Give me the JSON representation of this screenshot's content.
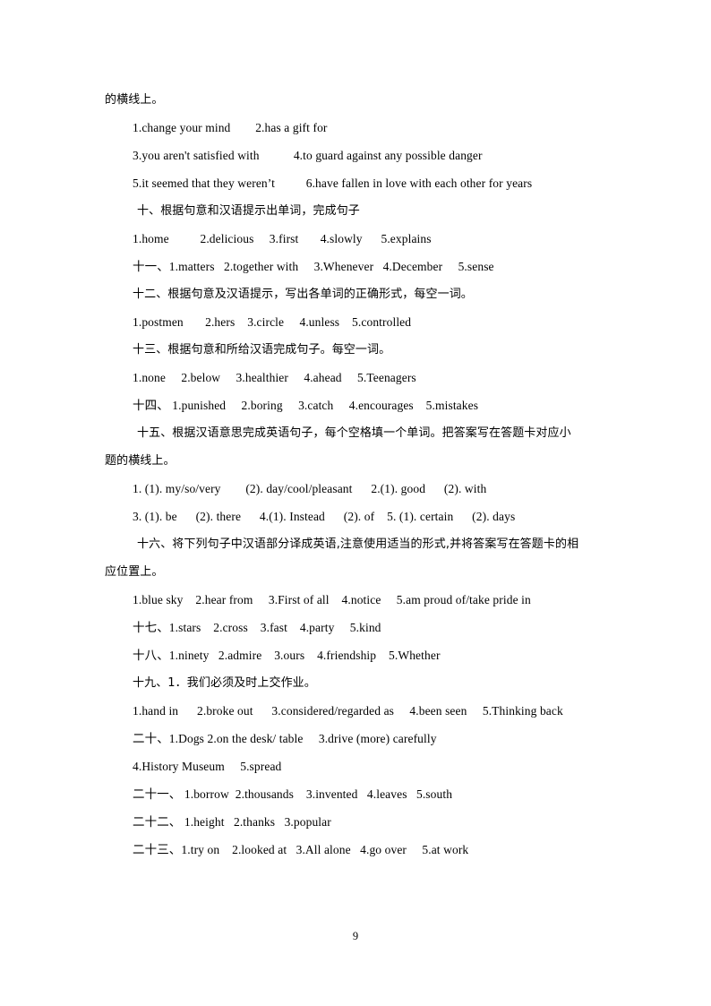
{
  "document": {
    "page_number": "9",
    "lines": [
      {
        "id": "carry-over-line",
        "indent": "flush",
        "script": "cjk",
        "text": "的横线上。"
      },
      {
        "id": "section-9-answers-row-1",
        "indent": "answers",
        "script": "latin",
        "text": "1.change your mind        2.has a gift for"
      },
      {
        "id": "section-9-answers-row-2",
        "indent": "answers",
        "script": "latin",
        "text": "3.you aren't satisfied with           4.to guard against any possible danger"
      },
      {
        "id": "section-9-answers-row-3",
        "indent": "answers",
        "script": "latin",
        "text": "5.it seemed that they weren’t          6.have fallen in love with each other for years"
      },
      {
        "id": "section-10-heading",
        "indent": "heading",
        "script": "cjk",
        "text": "十、根据句意和汉语提示出单词，完成句子"
      },
      {
        "id": "section-10-answers",
        "indent": "answers",
        "script": "latin",
        "text": "1.home          2.delicious     3.first       4.slowly      5.explains"
      },
      {
        "id": "section-11-heading-answers",
        "indent": "heading-inline",
        "script": "mixed",
        "text": "十一、1.matters   2.together with     3.Whenever   4.December     5.sense"
      },
      {
        "id": "section-12-heading",
        "indent": "heading-inline",
        "script": "cjk",
        "text": "十二、根据句意及汉语提示，写出各单词的正确形式，每空一词。"
      },
      {
        "id": "section-12-answers",
        "indent": "answers",
        "script": "latin",
        "text": "1.postmen       2.hers    3.circle     4.unless    5.controlled"
      },
      {
        "id": "section-13-heading",
        "indent": "heading-inline",
        "script": "cjk",
        "text": "十三、根据句意和所给汉语完成句子。每空一词。"
      },
      {
        "id": "section-13-answers",
        "indent": "answers",
        "script": "latin",
        "text": "1.none     2.below     3.healthier     4.ahead     5.Teenagers"
      },
      {
        "id": "section-14-heading-answers",
        "indent": "heading-inline",
        "script": "mixed",
        "text": "十四、 1.punished     2.boring     3.catch     4.encourages    5.mistakes"
      },
      {
        "id": "section-15-heading",
        "indent": "heading",
        "script": "cjk",
        "text": "十五、根据汉语意思完成英语句子，每个空格填一个单词。把答案写在答题卡对应小"
      },
      {
        "id": "section-15-heading-cont",
        "indent": "flush",
        "script": "cjk",
        "text": "题的横线上。"
      },
      {
        "id": "section-15-answers-row-1",
        "indent": "answers",
        "script": "latin",
        "text": "1. (1). my/so/very        (2). day/cool/pleasant      2.(1). good      (2). with"
      },
      {
        "id": "section-15-answers-row-2",
        "indent": "answers",
        "script": "latin",
        "text": "3. (1). be      (2). there      4.(1). Instead      (2). of    5. (1). certain      (2). days"
      },
      {
        "id": "section-16-heading",
        "indent": "heading",
        "script": "cjk",
        "text": "十六、将下列句子中汉语部分译成英语,注意使用适当的形式,并将答案写在答题卡的相"
      },
      {
        "id": "section-16-heading-cont",
        "indent": "flush",
        "script": "cjk",
        "text": "应位置上。"
      },
      {
        "id": "section-16-answers",
        "indent": "answers",
        "script": "latin",
        "text": "1.blue sky    2.hear from     3.First of all    4.notice     5.am proud of/take pride in"
      },
      {
        "id": "section-17-heading-answers",
        "indent": "heading-inline",
        "script": "mixed",
        "text": "十七、1.stars    2.cross    3.fast    4.party     5.kind"
      },
      {
        "id": "section-18-heading-answers",
        "indent": "heading-inline",
        "script": "mixed",
        "text": "十八、1.ninety   2.admire    3.ours    4.friendship    5.Whether"
      },
      {
        "id": "section-19-heading",
        "indent": "heading-inline",
        "script": "cjk",
        "text": "十九、1．我们必须及时上交作业。"
      },
      {
        "id": "section-19-answers",
        "indent": "answers",
        "script": "latin",
        "text": "1.hand in      2.broke out      3.considered/regarded as     4.been seen     5.Thinking back"
      },
      {
        "id": "section-20-heading-answers",
        "indent": "heading-inline",
        "script": "mixed",
        "text": "二十、1.Dogs 2.on the desk/ table     3.drive (more) carefully"
      },
      {
        "id": "section-20-answers-cont",
        "indent": "answers",
        "script": "latin",
        "text": "4.History Museum     5.spread"
      },
      {
        "id": "section-21-heading-answers",
        "indent": "heading-inline",
        "script": "mixed",
        "text": "二十一、 1.borrow  2.thousands    3.invented   4.leaves   5.south"
      },
      {
        "id": "section-22-heading-answers",
        "indent": "heading-inline",
        "script": "mixed",
        "text": "二十二、 1.height   2.thanks   3.popular"
      },
      {
        "id": "section-23-heading-answers",
        "indent": "heading-inline",
        "script": "mixed",
        "text": "二十三、1.try on    2.looked at   3.All alone   4.go over     5.at work"
      }
    ]
  }
}
